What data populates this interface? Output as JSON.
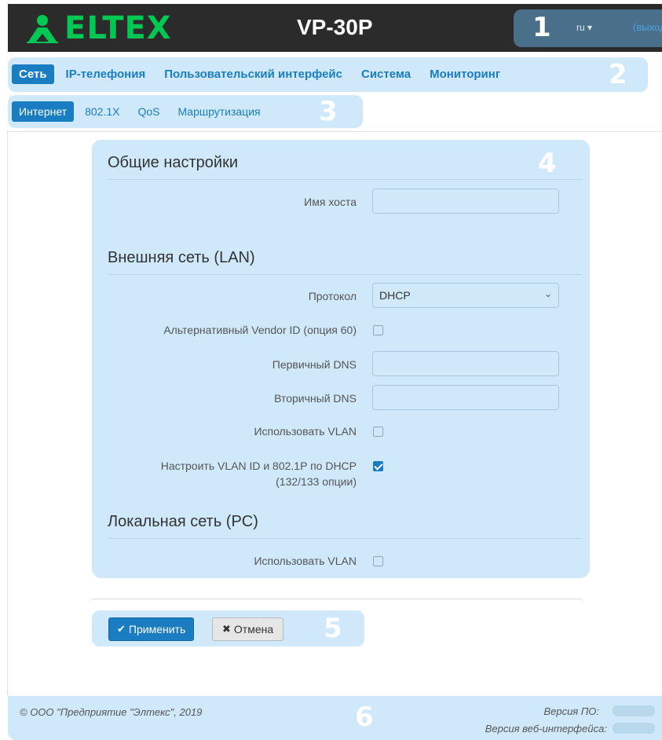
{
  "header": {
    "logo": "ELTEX",
    "model": "VP-30P",
    "lang": "ru ▾",
    "logout": "(выход"
  },
  "badges": [
    "1",
    "2",
    "3",
    "4",
    "5",
    "6"
  ],
  "nav_main": {
    "items": [
      {
        "label": "Сеть",
        "active": true
      },
      {
        "label": "IP-телефония",
        "active": false
      },
      {
        "label": "Пользовательский интерфейс",
        "active": false
      },
      {
        "label": "Система",
        "active": false
      },
      {
        "label": "Мониторинг",
        "active": false
      }
    ]
  },
  "nav_sub": {
    "items": [
      {
        "label": "Интернет",
        "active": true
      },
      {
        "label": "802.1X",
        "active": false
      },
      {
        "label": "QoS",
        "active": false
      },
      {
        "label": "Маршрутизация",
        "active": false
      }
    ]
  },
  "form": {
    "general": {
      "title": "Общие настройки",
      "hostname_label": "Имя хоста",
      "hostname_value": ""
    },
    "lan": {
      "title": "Внешняя сеть (LAN)",
      "protocol_label": "Протокол",
      "protocol_value": "DHCP",
      "alt_vendor_label": "Альтернативный Vendor ID (опция 60)",
      "alt_vendor_checked": false,
      "dns1_label": "Первичный DNS",
      "dns1_value": "",
      "dns2_label": "Вторичный DNS",
      "dns2_value": "",
      "vlan_label": "Использовать VLAN",
      "vlan_checked": false,
      "vlan_dhcp_label_1": "Настроить VLAN ID и 802.1P по DHCP",
      "vlan_dhcp_label_2": "(132/133 опции)",
      "vlan_dhcp_checked": true
    },
    "pc": {
      "title": "Локальная сеть (PC)",
      "vlan_label": "Использовать VLAN",
      "vlan_checked": false
    }
  },
  "actions": {
    "apply_label": "Применить",
    "cancel_label": "Отмена"
  },
  "footer": {
    "copyright": "© ООО \"Предприятие \"Элтекс\", 2019",
    "fw_label": "Версия ПО:",
    "web_label": "Версия веб-интерфейса:"
  },
  "colors": {
    "brand_green": "#00c853",
    "accent_blue": "#1a7dc2",
    "highlight": "#cfe9fa",
    "topbar": "#2b2b2b"
  }
}
